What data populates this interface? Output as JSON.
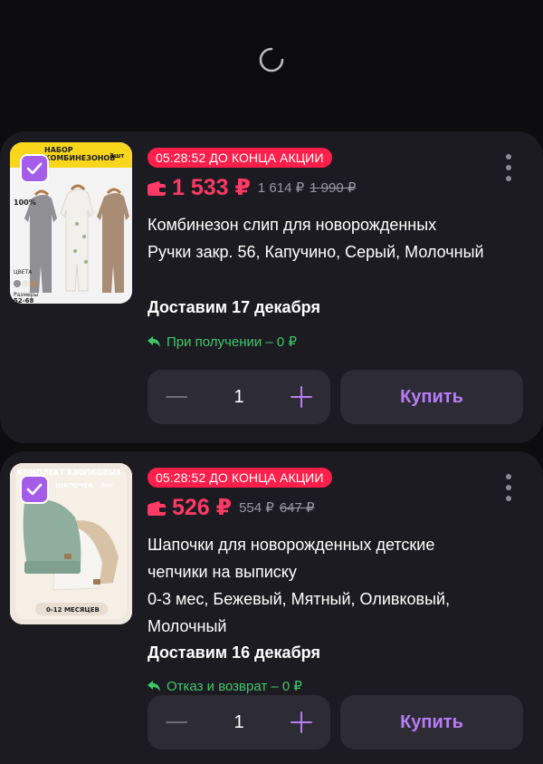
{
  "colors": {
    "background": "#0d0d10",
    "card": "#1c1b22",
    "accent_purple": "#b87cf6",
    "timer_red": "#ff1f4b",
    "price_red": "#ff3a64",
    "return_green": "#3ec869"
  },
  "loading": {
    "icon": "spinner-icon"
  },
  "products": [
    {
      "selected": true,
      "image_text": {
        "banner": "НАБОР КОМБИНЕЗОНОВ",
        "count": "3шт",
        "cotton": "100%",
        "colors_label": "ЦВЕТА",
        "sizes_label": "Размеры",
        "sizes": "52-68"
      },
      "timer": "05:28:52 ДО КОНЦА АКЦИИ",
      "price": "1 533 ₽",
      "price_card": "1 614 ₽",
      "price_old": "1 990 ₽",
      "title": "Комбинезон слип для новорожденных",
      "options": "Ручки закр. 56, Капучино, Серый, Молочный",
      "delivery": "Доставим 17 декабря",
      "return_info": "При получении – 0 ₽",
      "quantity": "1",
      "buy_label": "Купить"
    },
    {
      "selected": true,
      "image_text": {
        "banner": "КОМПЛЕКТ ХЛОПКОВЫХ",
        "banner2": "ШАПОЧЕК",
        "count": "3шт",
        "age": "0-12 МЕСЯЦЕВ"
      },
      "timer": "05:28:52 ДО КОНЦА АКЦИИ",
      "price": "526 ₽",
      "price_card": "554 ₽",
      "price_old": "647 ₽",
      "title": "Шапочки для новорожденных детские чепчики на выписку",
      "options": "0-3 мес, Бежевый, Мятный, Оливковый, Молочный",
      "delivery": "Доставим 16 декабря",
      "return_info": "Отказ и возврат – 0 ₽",
      "quantity": "1",
      "buy_label": "Купить"
    }
  ]
}
